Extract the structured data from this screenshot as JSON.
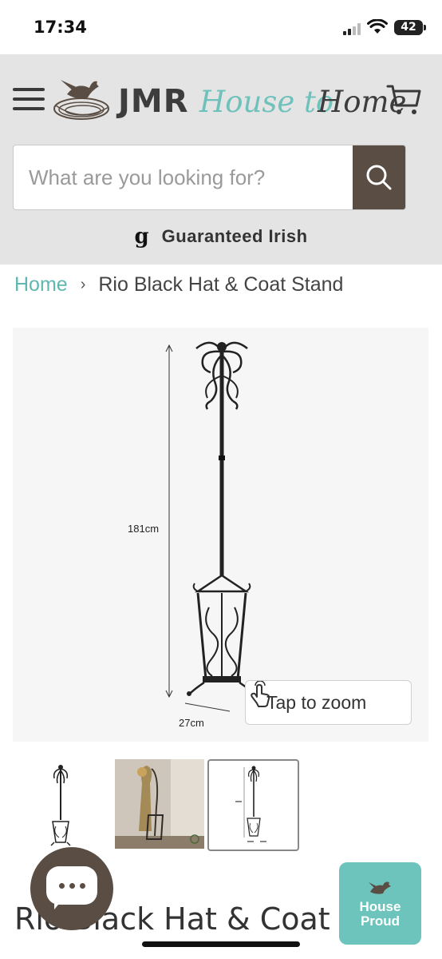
{
  "status_bar": {
    "time": "17:34",
    "battery": "42"
  },
  "header": {
    "logo": {
      "brand": "JMR",
      "tagline_part1": "House to",
      "tagline_part2": "Home"
    },
    "search": {
      "placeholder": "What are you looking for?"
    },
    "guarantee": {
      "icon": "g",
      "text": "Guaranteed Irish"
    }
  },
  "breadcrumb": {
    "home": "Home",
    "separator": "›",
    "current": "Rio Black Hat & Coat Stand"
  },
  "gallery": {
    "dimension_height": "181cm",
    "dimension_width": "27cm",
    "zoom_label": "Tap to zoom",
    "thumbnails": [
      "thumb-product-front",
      "thumb-product-lifestyle",
      "thumb-product-dimensions"
    ]
  },
  "badge": {
    "text_line1": "House",
    "text_line2": "Proud"
  },
  "product": {
    "title": "Rio Black Hat & Coat St"
  },
  "colors": {
    "accent_teal": "#6fc2bb",
    "brand_brown": "#5a4d44",
    "header_bg": "#e4e4e4"
  }
}
